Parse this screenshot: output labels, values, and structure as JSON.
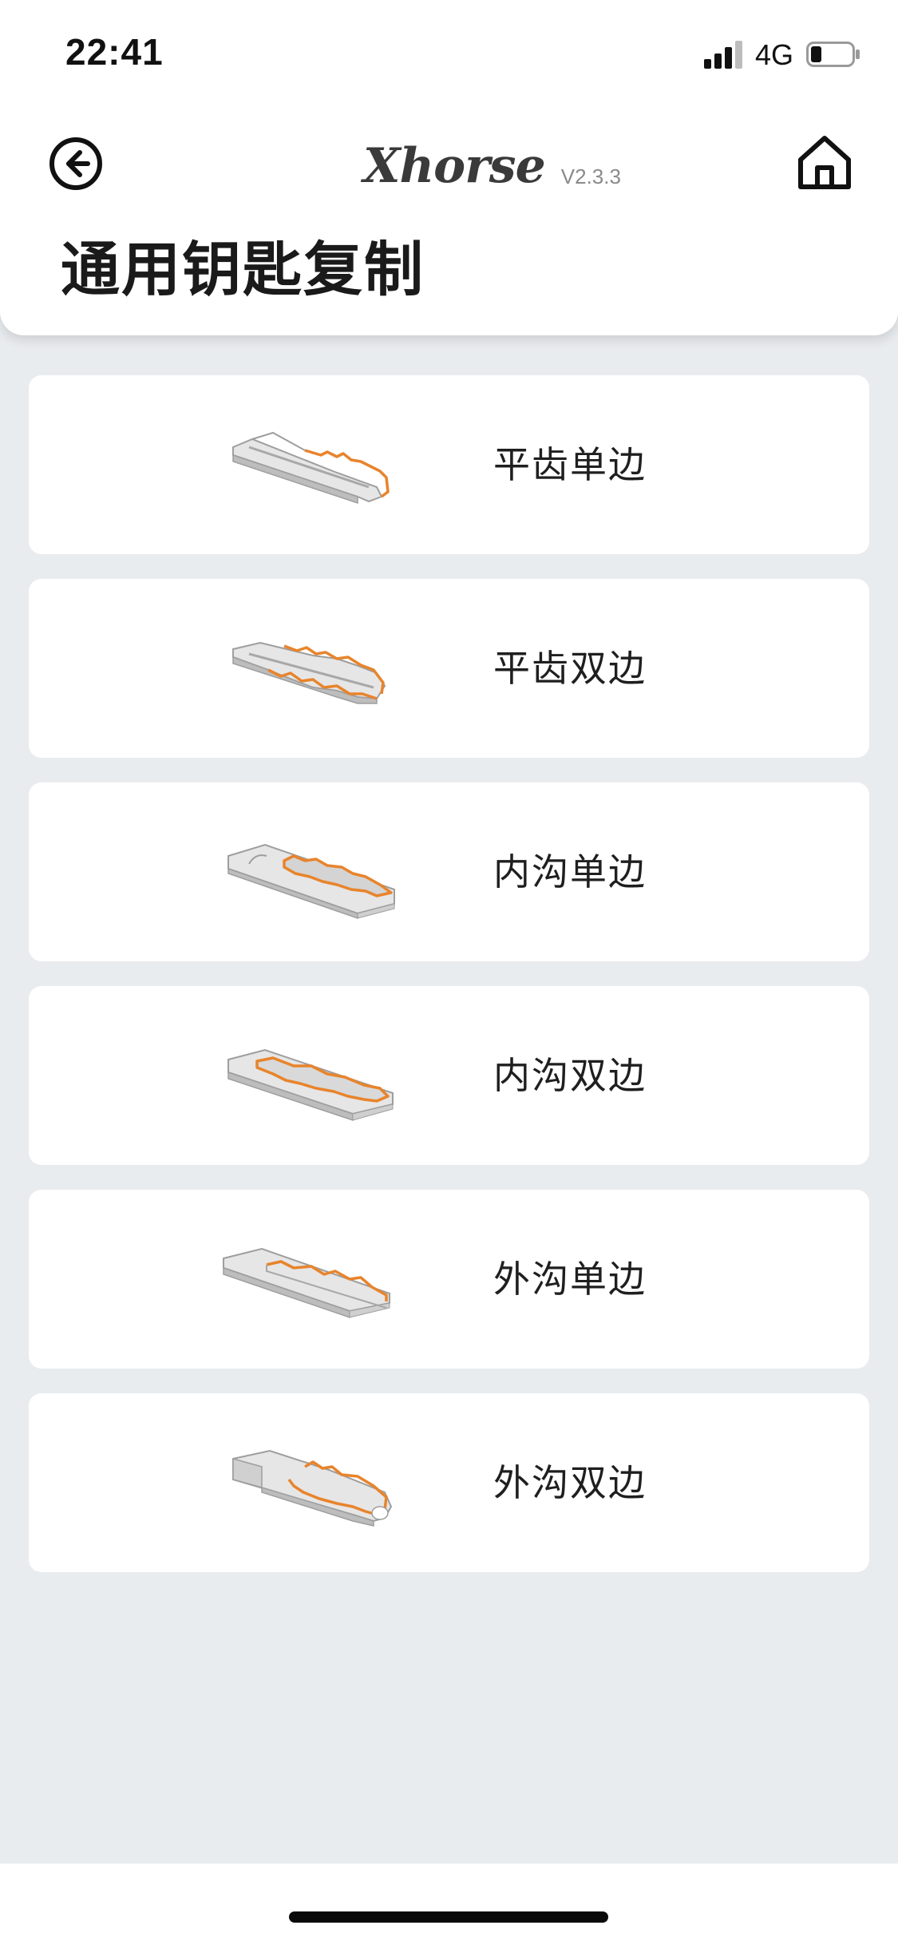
{
  "status_bar": {
    "time": "22:41",
    "network": "4G"
  },
  "nav": {
    "brand": "Xhorse",
    "version": "V2.3.3"
  },
  "page": {
    "title": "通用钥匙复制"
  },
  "colors": {
    "accent": "#e8842c",
    "key_body": "#d9d9d9",
    "background": "#e9ecef"
  },
  "items": [
    {
      "label": "平齿单边",
      "icon": "flat-single-key-icon"
    },
    {
      "label": "平齿双边",
      "icon": "flat-double-key-icon"
    },
    {
      "label": "内沟单边",
      "icon": "internal-groove-single-key-icon"
    },
    {
      "label": "内沟双边",
      "icon": "internal-groove-double-key-icon"
    },
    {
      "label": "外沟单边",
      "icon": "external-groove-single-key-icon"
    },
    {
      "label": "外沟双边",
      "icon": "external-groove-double-key-icon"
    }
  ]
}
